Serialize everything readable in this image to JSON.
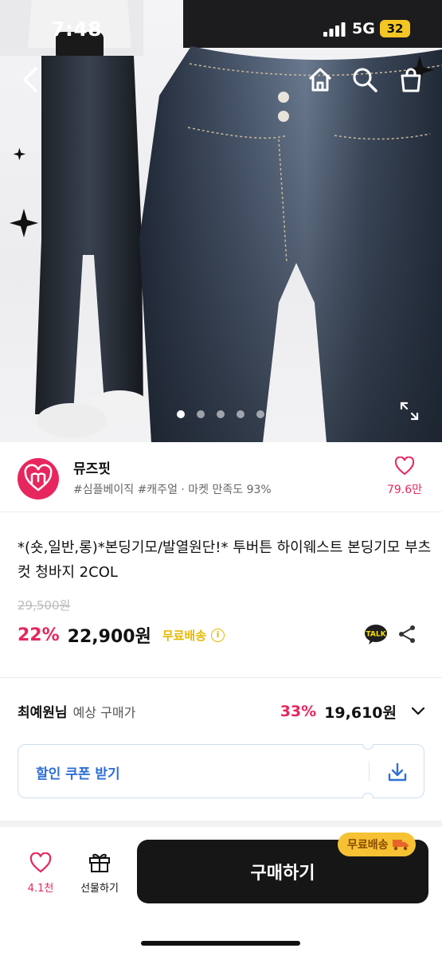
{
  "status_bar": {
    "time": "7:48",
    "network": "5G",
    "battery": "32"
  },
  "hero": {
    "nav": [
      "back-icon",
      "home-icon",
      "search-icon",
      "cart-icon"
    ],
    "pager": {
      "count": 5,
      "active_index": 0
    }
  },
  "shop": {
    "name": "뮤즈핏",
    "meta": "#심플베이직 #캐주얼 · 마켓 만족도 93%",
    "like_count": "79.6만"
  },
  "product": {
    "title": "*(숏,일반,롱)*본딩기모/발열원단!* 투버튼 하이웨스트 본딩기모 부츠컷 청바지 2COL",
    "original_price": "29,500원",
    "discount": "22%",
    "price": "22,900원",
    "free_shipping": "무료배송",
    "info_glyph": "i",
    "talk_badge": "TALK"
  },
  "expected": {
    "user": "최예원님",
    "label": "예상 구매가",
    "discount": "33%",
    "amount": "19,610원"
  },
  "coupon": {
    "label": "할인 쿠폰 받기"
  },
  "bottom_bar": {
    "like_count": "4.1천",
    "gift_label": "선물하기",
    "buy_label": "구매하기",
    "shipping_badge": "무료배송"
  },
  "colors": {
    "accent": "#e8265e",
    "blue": "#2f6fd6",
    "yellow": "#f6c233",
    "dark": "#161616"
  }
}
